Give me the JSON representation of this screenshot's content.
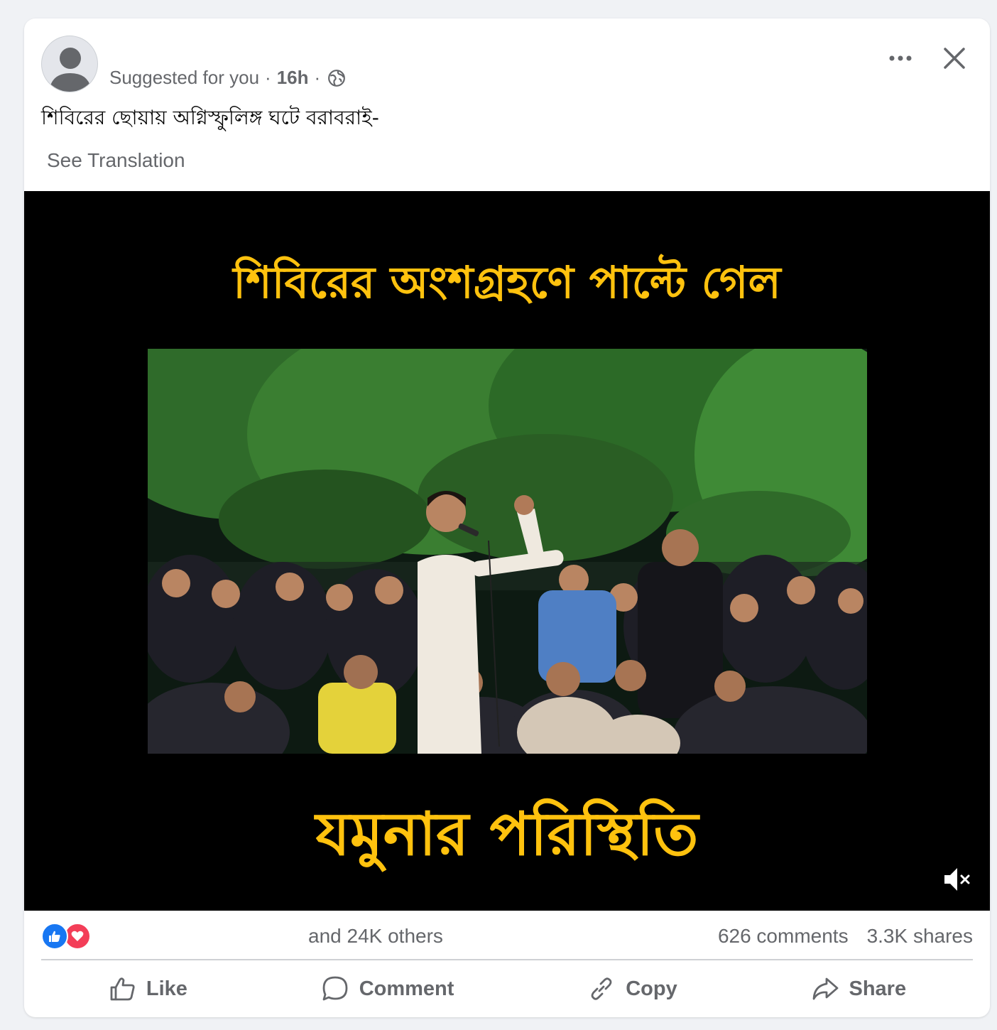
{
  "post": {
    "meta": {
      "label": "Suggested for you",
      "separator": "·",
      "time": "16h",
      "audience_icon": "globe-icon"
    },
    "caption": "শিবিরের ছোয়ায় অগ্নিস্ফুলিঙ্গ ঘটে বরাবরাই-",
    "see_translation": "See Translation",
    "video": {
      "headline_top": "শিবিরের অংশগ্রহণে  পাল্টে গেল",
      "headline_bottom": "যমুনার পরিস্থিতি",
      "mute_icon": "volume-muted-icon"
    },
    "stats": {
      "reactions": [
        "like-reaction-icon",
        "love-reaction-icon"
      ],
      "others": "and 24K others",
      "comments": "626 comments",
      "shares": "3.3K shares"
    },
    "actions": {
      "like": "Like",
      "comment": "Comment",
      "copy": "Copy",
      "share": "Share"
    }
  },
  "colors": {
    "headline": "#ffc20e",
    "like_blue": "#1877f2",
    "love_red": "#f33e58",
    "secondary_text": "#65676b"
  }
}
